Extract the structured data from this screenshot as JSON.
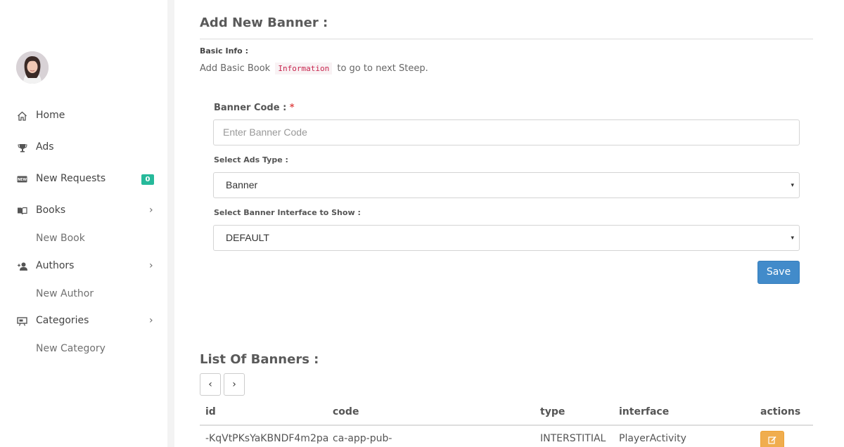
{
  "sidebar": {
    "items": [
      {
        "label": "Home",
        "icon": "home-icon"
      },
      {
        "label": "Ads",
        "icon": "trophy-icon"
      },
      {
        "label": "New Requests",
        "icon": "new-icon",
        "badge": "0"
      },
      {
        "label": "Books",
        "icon": "book-icon",
        "chevron": "›"
      },
      {
        "label": "Authors",
        "icon": "user-add-icon",
        "chevron": "›"
      },
      {
        "label": "Categories",
        "icon": "presentation-icon",
        "chevron": "›"
      }
    ],
    "sub_items": {
      "new_book": "New Book",
      "new_author": "New Author",
      "new_category": "New Category"
    }
  },
  "page": {
    "title": "Add New Banner :",
    "basic_info_label": "Basic Info :",
    "hint_before": "Add Basic Book",
    "hint_code": "Information",
    "hint_after": "to go to next Steep."
  },
  "form": {
    "banner_code_label": "Banner Code :",
    "required_mark": "*",
    "banner_code_placeholder": "Enter Banner Code",
    "ads_type_label": "Select Ads Type :",
    "ads_type_value": "Banner",
    "interface_label": "Select Banner Interface to Show :",
    "interface_value": "DEFAULT",
    "caret": "▾",
    "save_label": "Save"
  },
  "list": {
    "title": "List Of Banners :",
    "prev": "‹",
    "next": "›",
    "columns": [
      "id",
      "code",
      "type",
      "interface",
      "actions"
    ],
    "rows": [
      {
        "id": "-KqVtPKsYaKBNDF4m2pa",
        "code": "ca-app-pub-",
        "type": "INTERSTITIAL",
        "interface": "PlayerActivity"
      }
    ]
  },
  "colors": {
    "primary_button": "#428bca",
    "badge": "#26b99a",
    "edit_button": "#f0ad4e",
    "required": "#e04b4b"
  }
}
